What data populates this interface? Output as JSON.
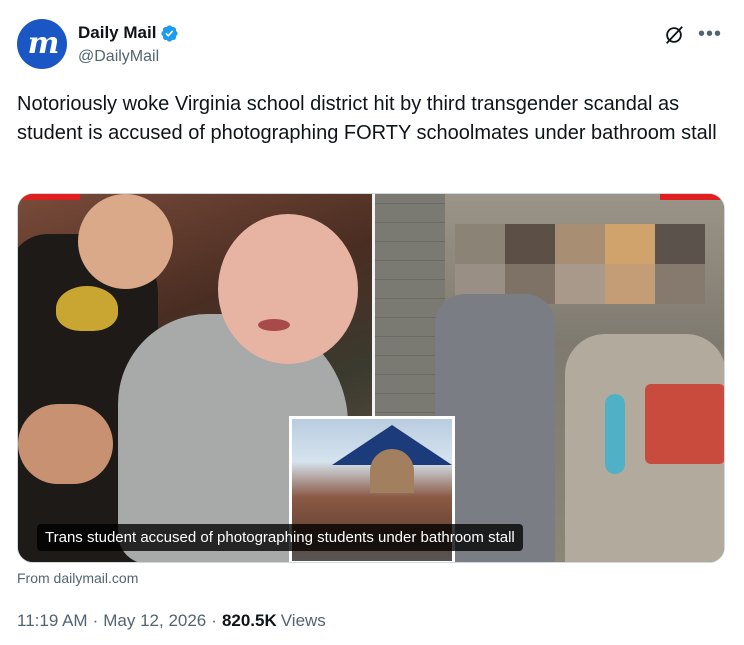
{
  "author": {
    "display_name": "Daily Mail",
    "handle": "@DailyMail",
    "avatar_letters": "m",
    "avatar_color": "#1a56c4",
    "verified": true
  },
  "tweet": {
    "text": "Notoriously woke Virginia school district hit by third transgender scandal as student is accused of photographing FORTY schoolmates under bathroom stall"
  },
  "card": {
    "caption": "Trans student accused of photographing students under bathroom stall",
    "source": "From dailymail.com"
  },
  "meta": {
    "time": "11:19 AM",
    "date": "May 12, 2026",
    "separator": "·",
    "views_count": "820.5K",
    "views_label": "Views"
  },
  "icons": {
    "grok": "grok-icon",
    "more": "more-icon",
    "verified": "verified-badge-icon"
  },
  "colors": {
    "accent": "#1d9bf0",
    "text_primary": "#0f1419",
    "text_secondary": "#536471"
  }
}
